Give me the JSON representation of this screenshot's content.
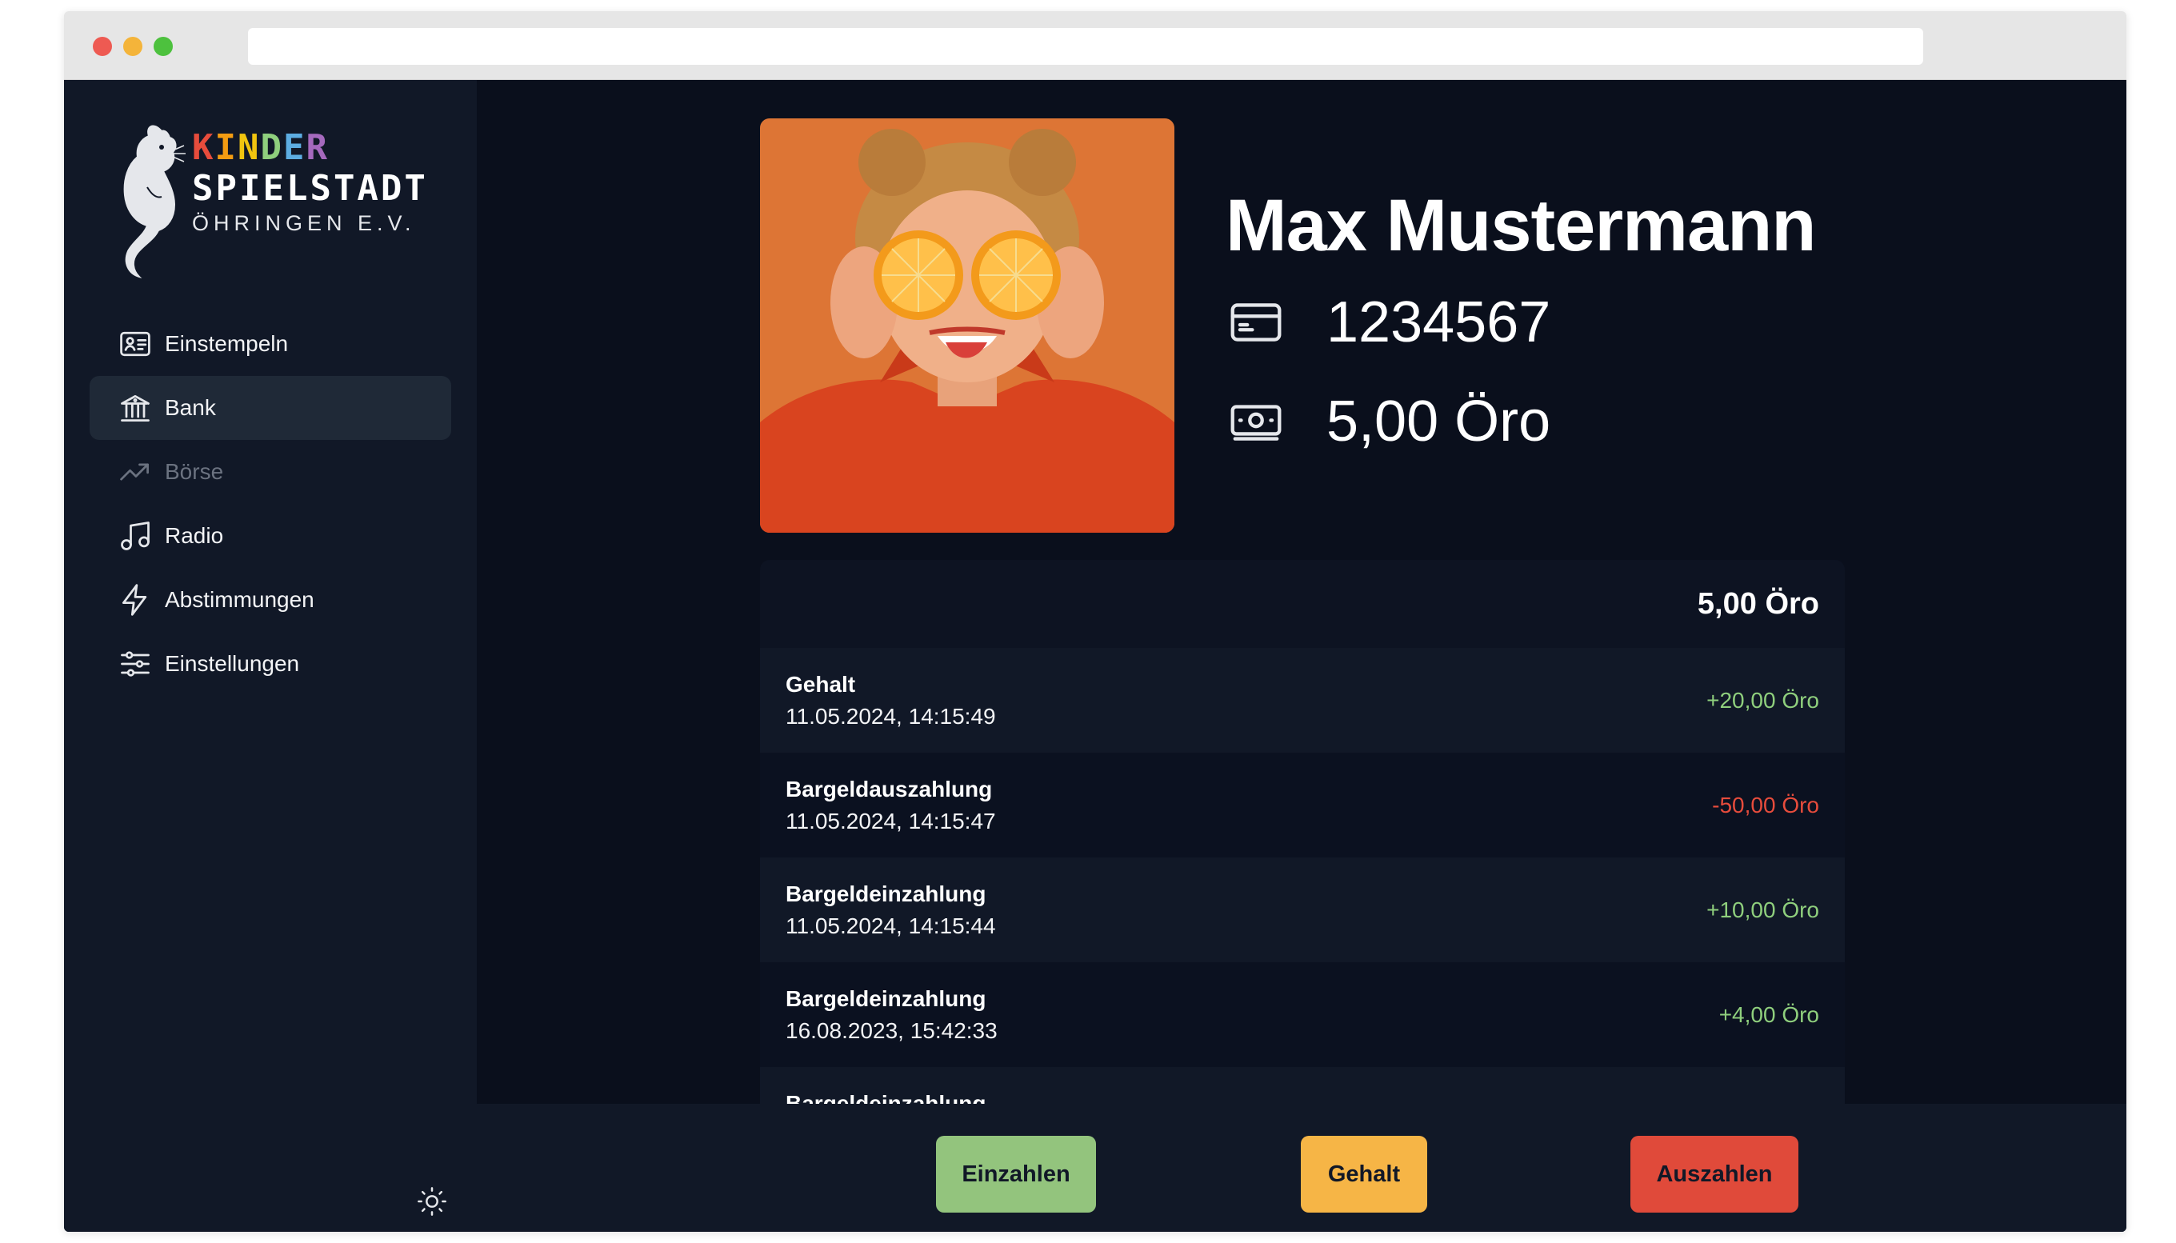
{
  "logo": {
    "kinder_letters": [
      {
        "ch": "K",
        "color": "#e74c3c"
      },
      {
        "ch": "I",
        "color": "#f39c12"
      },
      {
        "ch": "N",
        "color": "#f1c40f"
      },
      {
        "ch": "D",
        "color": "#8fcf7d"
      },
      {
        "ch": "E",
        "color": "#5dade2"
      },
      {
        "ch": "R",
        "color": "#a569bd"
      }
    ],
    "line2": "SPIELSTADT",
    "line3": "ÖHRINGEN E.V."
  },
  "sidebar": {
    "items": [
      {
        "label": "Einstempeln",
        "icon": "id-card-icon",
        "active": false,
        "disabled": false
      },
      {
        "label": "Bank",
        "icon": "bank-icon",
        "active": true,
        "disabled": false
      },
      {
        "label": "Börse",
        "icon": "trending-up-icon",
        "active": false,
        "disabled": true
      },
      {
        "label": "Radio",
        "icon": "music-note-icon",
        "active": false,
        "disabled": false
      },
      {
        "label": "Abstimmungen",
        "icon": "lightning-icon",
        "active": false,
        "disabled": false
      },
      {
        "label": "Einstellungen",
        "icon": "sliders-icon",
        "active": false,
        "disabled": false
      }
    ],
    "theme_icon": "sun-icon"
  },
  "profile": {
    "name": "Max Mustermann",
    "card_number": "1234567",
    "balance": "5,00 Öro",
    "card_icon": "credit-card-icon",
    "balance_icon": "banknote-icon"
  },
  "transactions": {
    "total": "5,00 Öro",
    "rows": [
      {
        "title": "Gehalt",
        "date": "11.05.2024, 14:15:49",
        "amount": "+20,00 Öro",
        "sign": "pos"
      },
      {
        "title": "Bargeldauszahlung",
        "date": "11.05.2024, 14:15:47",
        "amount": "-50,00 Öro",
        "sign": "neg"
      },
      {
        "title": "Bargeldeinzahlung",
        "date": "11.05.2024, 14:15:44",
        "amount": "+10,00 Öro",
        "sign": "pos"
      },
      {
        "title": "Bargeldeinzahlung",
        "date": "16.08.2023, 15:42:33",
        "amount": "+4,00 Öro",
        "sign": "pos"
      },
      {
        "title": "Bargeldeinzahlung",
        "date": "",
        "amount": "",
        "sign": "pos"
      }
    ]
  },
  "actions": {
    "deposit": "Einzahlen",
    "salary": "Gehalt",
    "withdraw": "Auszahlen"
  },
  "colors": {
    "positive": "#8fcf7d",
    "negative": "#e74c3c",
    "deposit_button": "#93c47d",
    "salary_button": "#f6b546",
    "withdraw_button": "#e04a3a"
  }
}
